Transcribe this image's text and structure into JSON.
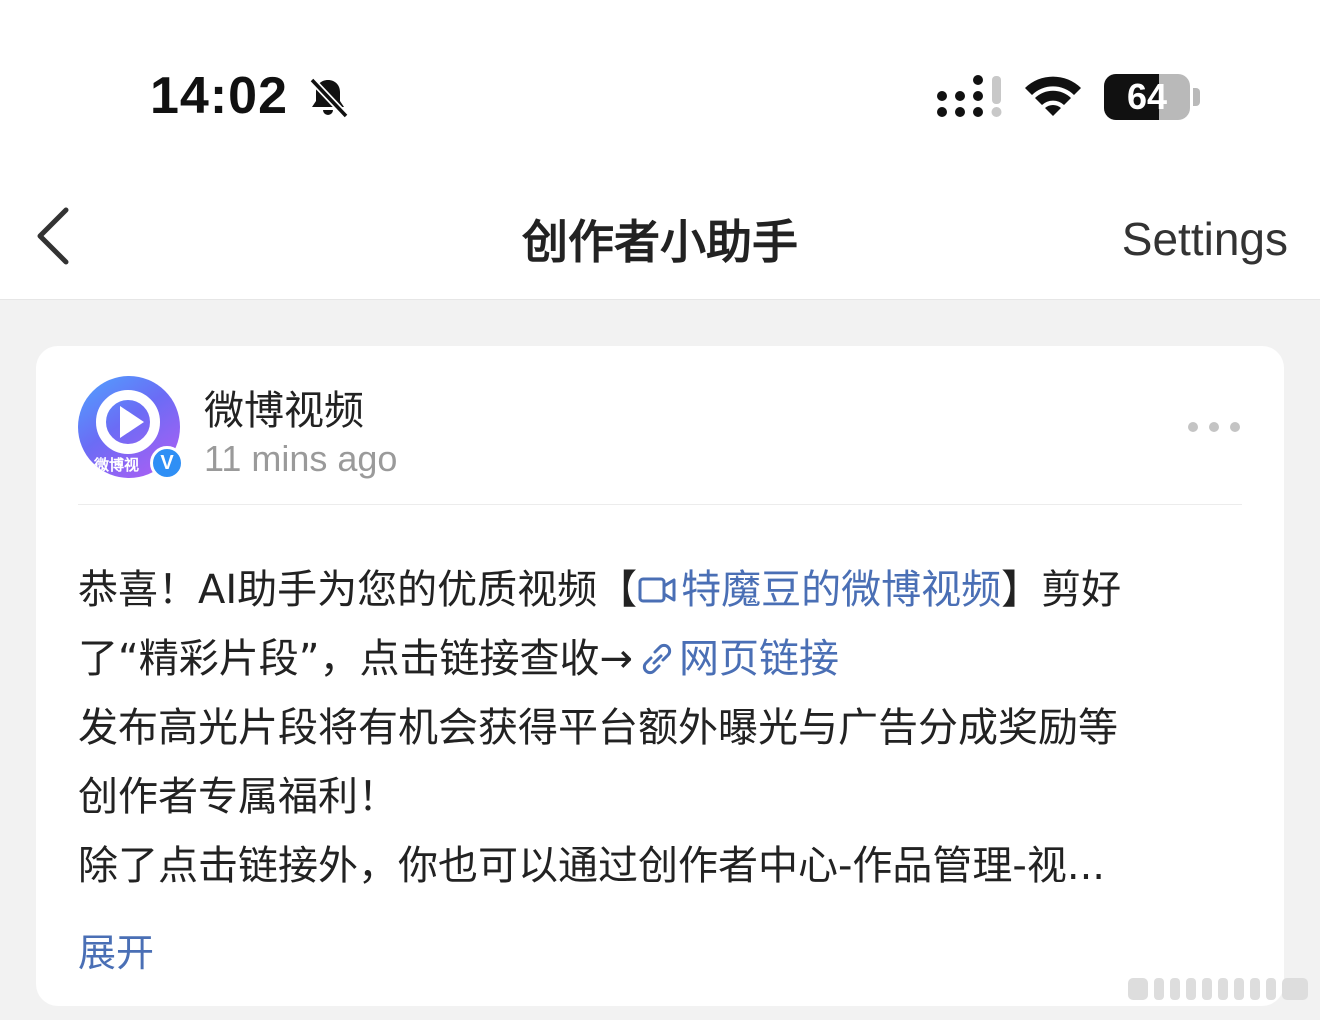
{
  "status_bar": {
    "time": "14:02",
    "battery_level": "64",
    "battery_fraction": 0.64,
    "icons": [
      "bell-slash-icon",
      "cellular-signal-icon",
      "wifi-icon",
      "battery-icon"
    ]
  },
  "nav": {
    "title": "创作者小助手",
    "settings_label": "Settings",
    "back_icon": "chevron-left-icon"
  },
  "post": {
    "author": "微博视频",
    "avatar_text": "微博视",
    "verified_mark": "V",
    "time": "11 mins ago",
    "body": {
      "line1_prefix": "恭喜！AI助手为您的优质视频【",
      "video_link": "特魔豆的微博视频",
      "line1_suffix": "】剪好",
      "line2_prefix": "了“精彩片段”，点击链接查收→",
      "web_link": "网页链接",
      "line3": "发布高光片段将有机会获得平台额外曝光与广告分成奖励等",
      "line4": "创作者专属福利！",
      "line5": "除了点击链接外，你也可以通过创作者中心-作品管理-视..."
    },
    "expand_label": "展开"
  },
  "colors": {
    "link": "#4a6fb5",
    "verified": "#2f8ff5",
    "background": "#f2f2f2"
  }
}
